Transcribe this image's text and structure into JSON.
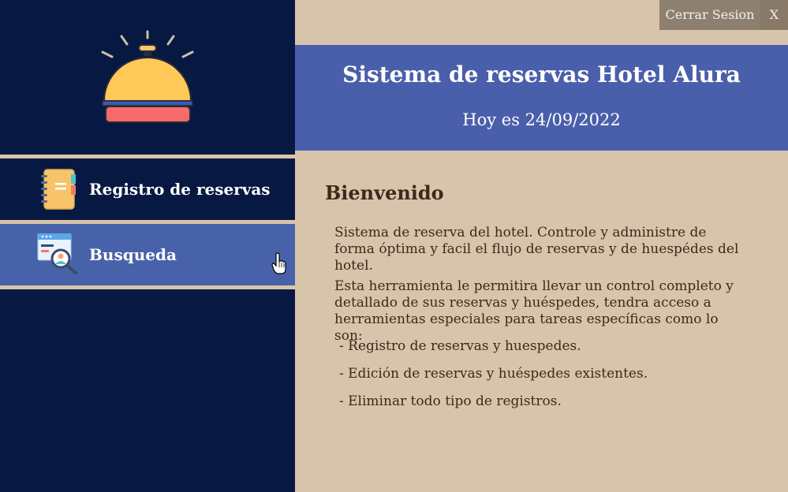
{
  "window": {
    "logout_label": "Cerrar Sesion",
    "close_label": "X"
  },
  "sidebar": {
    "logo_icon": "bell-icon",
    "items": [
      {
        "label": "Registro de reservas",
        "icon": "notebook-icon"
      },
      {
        "label": "Busqueda",
        "icon": "search-person-icon"
      }
    ]
  },
  "header": {
    "title": "Sistema de reservas Hotel Alura",
    "date_text": "Hoy es 24/09/2022"
  },
  "main": {
    "welcome": "Bienvenido",
    "paragraph1": "Sistema de reserva del hotel. Controle y administre de forma óptima y facil el flujo de reservas y de huespédes del hotel.",
    "paragraph2": "Esta herramienta le permitira llevar un control completo y detallado de sus reservas y huéspedes, tendra acceso a herramientas especiales para tareas específicas como lo son:",
    "bullets": [
      "- Registro de reservas y huespedes.",
      "- Edición de reservas y huéspedes existentes.",
      "- Eliminar todo tipo de registros."
    ]
  },
  "colors": {
    "sidebar_bg": "#071942",
    "accent_blue": "#4a5fab",
    "content_bg": "#d8c4ab",
    "text_dark": "#3a2a1a"
  }
}
